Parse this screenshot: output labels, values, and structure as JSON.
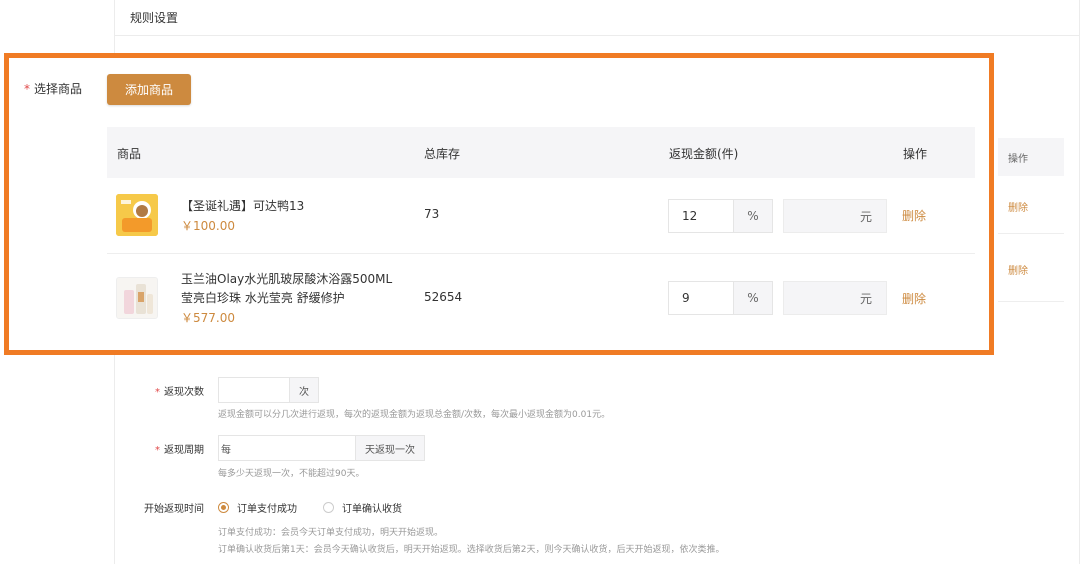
{
  "panel": {
    "title": "规则设置"
  },
  "ghost_table": {
    "header": "操作",
    "row_actions": [
      "删除",
      "删除"
    ]
  },
  "product_section": {
    "label": "选择商品",
    "required_mark": "*",
    "add_button": "添加商品",
    "columns": [
      "商品",
      "总库存",
      "返现金额(件)",
      "操作"
    ],
    "rows": [
      {
        "name_line1": "【圣诞礼遇】可达鸭13",
        "name_line2": "",
        "price": "￥100.00",
        "stock": "73",
        "cashback_value": "12",
        "cashback_unit": "%",
        "amount_unit": "元",
        "action": "删除"
      },
      {
        "name_line1": "玉兰油Olay水光肌玻尿酸沐浴露500ML",
        "name_line2": "莹亮白珍珠 水光莹亮 舒缓修护",
        "price": "￥577.00",
        "stock": "52654",
        "cashback_value": "9",
        "cashback_unit": "%",
        "amount_unit": "元",
        "action": "删除"
      }
    ]
  },
  "form": {
    "cashback_count": {
      "label": "返现次数",
      "unit": "次",
      "hint": "返现金额可以分几次进行返现，每次的返现金额为返现总金额/次数，每次最小返现金额为0.01元。"
    },
    "cashback_period": {
      "label": "返现周期",
      "prefix": "每",
      "suffix": "天返现一次",
      "hint": "每多少天返现一次，不能超过90天。"
    },
    "start_time": {
      "label": "开始返现时间",
      "options": [
        "订单支付成功",
        "订单确认收货"
      ],
      "selected": "订单支付成功",
      "hint1": "订单支付成功：会员今天订单支付成功，明天开始返现。",
      "hint2": "订单确认收货后第1天：会员今天确认收货后，明天开始返现。选择收货后第2天，则今天确认收货，后天开始返现，依次类推。"
    }
  },
  "colors": {
    "accent": "#cd8a3f",
    "highlight_border": "#f07b24",
    "required": "#e04848"
  }
}
